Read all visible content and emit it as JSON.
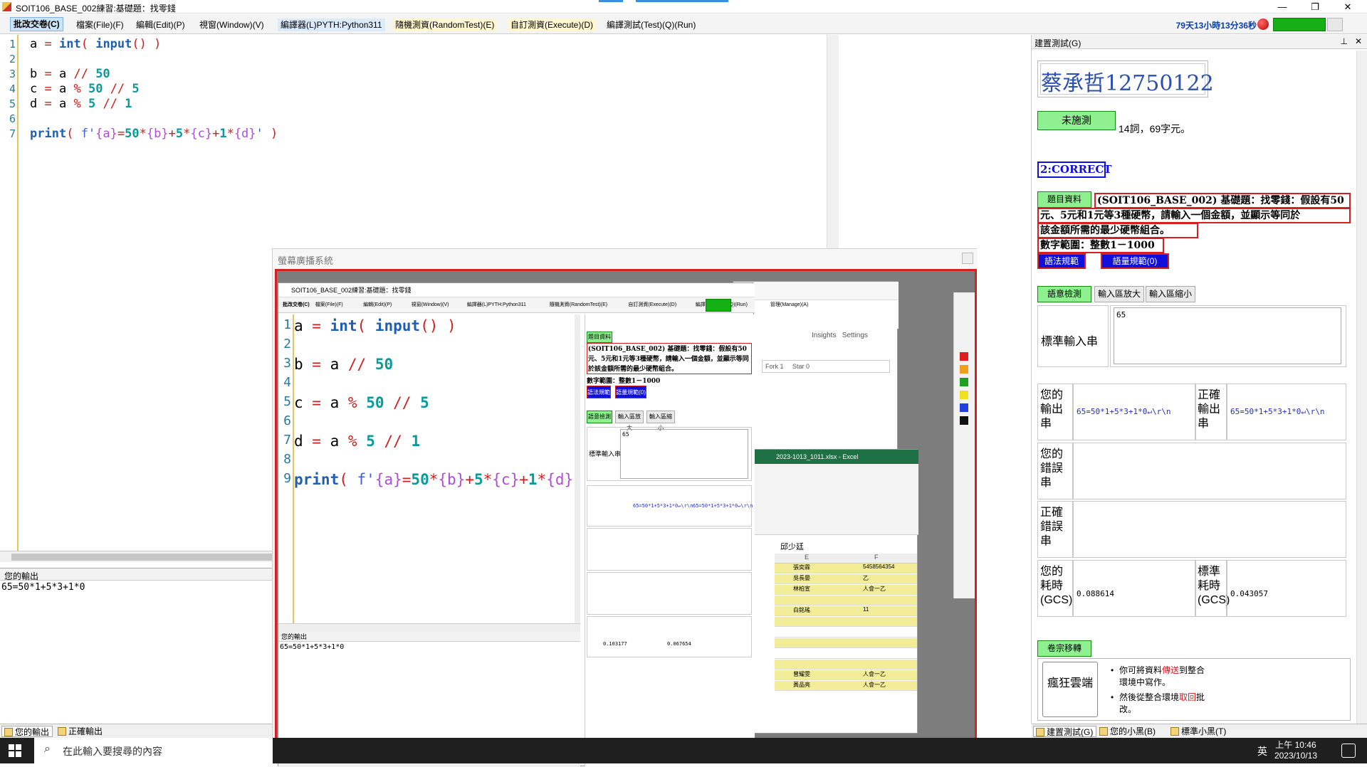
{
  "window": {
    "title": "SOIT106_BASE_002練習:基礎題：找零錢",
    "controls": [
      "—",
      "❐",
      "✕"
    ]
  },
  "menu": {
    "items": [
      {
        "label": "批改交卷(C)",
        "style": "active"
      },
      {
        "label": "檔案(File)(F)",
        "style": ""
      },
      {
        "label": "編輯(Edit)(P)",
        "style": ""
      },
      {
        "label": "視窗(Window)(V)",
        "style": ""
      },
      {
        "label": "編譯器(L)PYTH:Python311",
        "style": "blue"
      },
      {
        "label": "隨機測資(RandomTest)(E)",
        "style": "yellow"
      },
      {
        "label": "自訂測資(Execute)(D)",
        "style": "yellow"
      },
      {
        "label": "編譯測試(Test)(Q)(Run)",
        "style": ""
      }
    ],
    "timer": "79天13小時13分36秒"
  },
  "editor": {
    "lines": [
      {
        "n": "1",
        "text": "a = int( input() )"
      },
      {
        "n": "2",
        "text": ""
      },
      {
        "n": "3",
        "text": "b = a // 50"
      },
      {
        "n": "4",
        "text": "c = a % 50 // 5"
      },
      {
        "n": "5",
        "text": "d = a % 5 // 1"
      },
      {
        "n": "6",
        "text": ""
      },
      {
        "n": "7",
        "text": "print( f'{a}=50*{b}+5*{c}+1*{d}' )"
      }
    ]
  },
  "output": {
    "header": "您的輸出",
    "text": "65=50*1+5*3+1*0",
    "tabs": [
      "您的輸出",
      "正確輸出"
    ]
  },
  "right_panel": {
    "header": "建置測試(G)",
    "student": "蔡承哲12750122",
    "status_button": "未施測",
    "stats": "14詞，69字元。",
    "result": "2:CORRECT",
    "question_button": "題目資料",
    "question_title": "(SOIT106_BASE_002) 基礎題：找零錢：假設有50",
    "question_line2": "元、5元和1元等3種硬幣，請輸入一個金額，並顯示等同於",
    "question_line3": "該金額所需的最少硬幣組合。",
    "question_range": "數字範圍：整數1－1000",
    "syntax_btn": "語法規範",
    "amount_btn": "語量規範(0)",
    "tabs": [
      "語意檢測",
      "輸入區放大",
      "輸入區縮小"
    ],
    "std_input_label": "標準輸入串",
    "std_input_value": "65",
    "your_output_label": "您的輸出串",
    "your_output_value": "65=50*1+5*3+1*0↵\\r\\n",
    "correct_output_label": "正確輸出串",
    "correct_output_value": "65=50*1+5*3+1*0↵\\r\\n",
    "your_error_label": "您的錯誤串",
    "correct_error_label": "正確錯誤串",
    "your_time_label": "您的耗時(GCS)",
    "your_time_value": "0.088614",
    "std_time_label": "標準耗時(GCS)",
    "std_time_value": "0.043057",
    "move_section": "卷宗移轉",
    "cloud_btn": "瘋狂雲端",
    "bullet1_a": "你可將資料",
    "bullet1_b": "傳送",
    "bullet1_c": "到整合環境中寫作。",
    "bullet2_a": "然後從整合環境",
    "bullet2_b": "取回",
    "bullet2_c": "批改。",
    "bottom_tabs": [
      "建置測試(G)",
      "您的小黑(B)",
      "標準小黑(T)"
    ]
  },
  "broadcast": {
    "title": "螢幕廣播系統",
    "inner_title": "SOIT106_BASE_002練習:基礎題：找零錢",
    "inner_menu": [
      "批改交卷(C)",
      "檔案(File)(F)",
      "編輯(Edit)(P)",
      "視窗(Window)(V)",
      "編譯器(L)PYTH:Python311",
      "隨機測資(RandomTest)(E)",
      "自訂測資(Execute)(D)",
      "編譯測試(Test)(Q)(Run)",
      "管理(Manage)(A)"
    ],
    "inner_lines": [
      {
        "n": "1",
        "text": "a = int( input() )"
      },
      {
        "n": "2",
        "text": ""
      },
      {
        "n": "3",
        "text": "b = a // 50"
      },
      {
        "n": "4",
        "text": ""
      },
      {
        "n": "5",
        "text": "c = a % 50 // 5"
      },
      {
        "n": "6",
        "text": ""
      },
      {
        "n": "7",
        "text": "d = a % 5 // 1"
      },
      {
        "n": "8",
        "text": ""
      },
      {
        "n": "9",
        "text": "print( f'{a}=50*{b}+5*{c}+1*{d}'   )"
      }
    ],
    "inner_output_header": "您的輸出",
    "inner_output": "65=50*1+5*3+1*0",
    "inner_your_time": "0.103177",
    "inner_std_time": "0.067654",
    "excel_title": "2023-1013_1011.xlsx - Excel",
    "excel_cell_ref": "邱少廷",
    "excel_rows": [
      {
        "e": "張奕霖",
        "f": "5458564354"
      },
      {
        "e": "吳長晏",
        "f": "乙"
      },
      {
        "e": "林柏宣",
        "f": "人會一乙"
      },
      {
        "e": "",
        "f": ""
      },
      {
        "e": "白銘瑤",
        "f": "11"
      },
      {
        "e": "",
        "f": ""
      },
      {
        "e": "",
        "f": ""
      },
      {
        "e": "",
        "f": ""
      },
      {
        "e": "",
        "f": ""
      },
      {
        "e": "",
        "f": ""
      },
      {
        "e": "曾耀雯",
        "f": "人會一乙"
      },
      {
        "e": "黃品亮",
        "f": "人會一乙"
      }
    ]
  },
  "taskbar": {
    "search_placeholder": "在此輸入要搜尋的內容",
    "ime": "英",
    "time": "上午 10:46",
    "date": "2023/10/13"
  }
}
